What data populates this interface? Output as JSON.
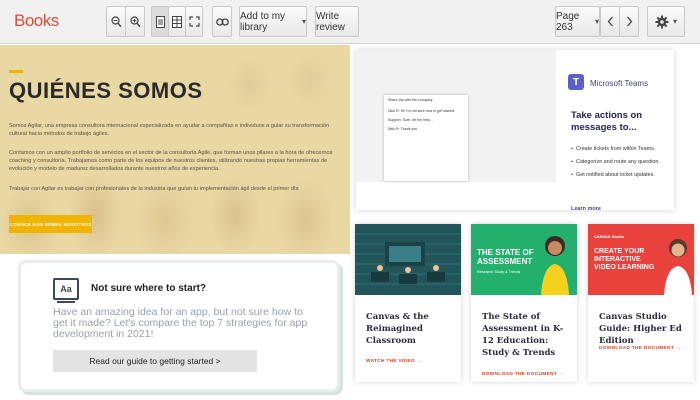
{
  "toolbar": {
    "app_name": "Books",
    "zoom_out_icon": "magnifier-minus-icon",
    "zoom_in_icon": "magnifier-plus-icon",
    "single_page_icon": "single-page-icon",
    "two_page_icon": "two-page-icon",
    "fullscreen_icon": "fullscreen-icon",
    "link_icon": "link-icon",
    "add_to_library_label": "Add to my library",
    "write_review_label": "Write review",
    "page_selector_label": "Page 263",
    "prev_icon": "chevron-left-icon",
    "next_icon": "chevron-right-icon",
    "settings_icon": "gear-icon"
  },
  "hero": {
    "title": "QUIÉNES SOMOS",
    "paragraph_1": "Somos Agilar, una empresa consultora internacional especializada en ayudar a compañías e individuos a guiar su transformación cultural hacia métodos de trabajo ágiles.",
    "paragraph_2": "Contamos con un amplio portfolio de servicios en el sector de la consultoría Agile, que forman unos pilares a la hora de ofrecernos coaching y consultoría. Trabajamos como parte de los equipos de nuestros clientes, utilizando nuestras propias herramientas de evolución y modelo de madurez desarrollados durante nuestros años de experiencia.",
    "paragraph_3": "Trabajar con Agilar es trabajar con profesionales de la industria que guían tu implementación ágil desde el primer día",
    "cta_label": "CONOCE MÁS SOBRE NOSOTROS"
  },
  "start_card": {
    "icon_text": "Aa",
    "title": "Not sure where to start?",
    "description": "Have an amazing idea for an app, but not sure how to get it made? Let's compare the top 7 strategies for app development in 2021!",
    "button_label": "Read our guide to getting started >"
  },
  "teams_card": {
    "logo_letter": "T",
    "product_name": "Microsoft Teams",
    "headline": "Take actions on messages to...",
    "bullets": [
      "Create tickets from within Teams.",
      "Categorize and route any question.",
      "Get notified about ticket updates."
    ],
    "learn_more_label": "Learn more",
    "mock_chat_lines": [
      "Share trip with the company",
      "Nick R: Hi! I'm not sure how to get started.",
      "Support: Sure, let me help...",
      "Nick R: Thank you"
    ]
  },
  "resource_cards": [
    {
      "title": "Canvas & the Reimagined Classroom",
      "link_label": "WATCH THE VIDEO →"
    },
    {
      "thumb_title": "THE STATE OF ASSESSMENT",
      "thumb_subtitle": "Research Study & Trends",
      "title": "The State of Assessment in K-12 Education: Study & Trends",
      "link_label": "DOWNLOAD THE DOCUMENT →"
    },
    {
      "thumb_tag": "CANVAS Studio",
      "thumb_title": "CREATE YOUR INTERACTIVE VIDEO LEARNING",
      "title": "Canvas Studio Guide: Higher Ed Edition",
      "link_label": "DOWNLOAD THE DOCUMENT →"
    }
  ],
  "colors": {
    "brand_red": "#dd4b39",
    "yellow_accent": "#f0b400",
    "teams_purple": "#5b5fc7",
    "link_orange": "#e0411d"
  }
}
